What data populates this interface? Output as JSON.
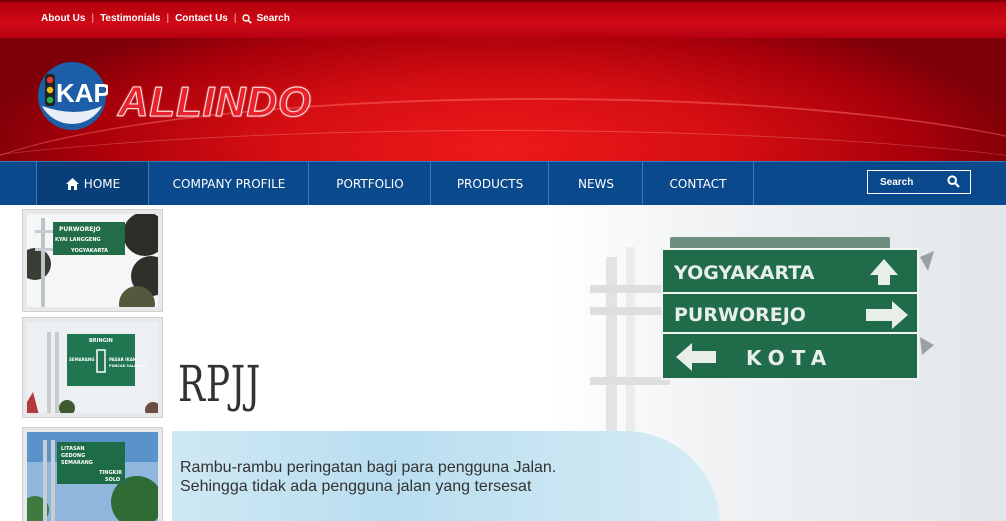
{
  "topbar": {
    "links": [
      "About Us",
      "Testimonials",
      "Contact Us"
    ],
    "search_label": "Search"
  },
  "brand": {
    "logo_badge": "KAP",
    "name": "ALLINDO"
  },
  "nav": {
    "items": [
      "HOME",
      "COMPANY PROFILE",
      "PORTFOLIO",
      "PRODUCTS",
      "NEWS",
      "CONTACT"
    ],
    "search_placeholder": "Search"
  },
  "slide": {
    "title": "RPJJ",
    "caption_line1": "Rambu-rambu peringatan bagi para pengguna Jalan.",
    "caption_line2": "Sehingga tidak ada pengguna jalan yang tersesat"
  },
  "thumbnails": [
    {
      "sign_lines": [
        "PURWOREJO",
        "KYAI LANGGENG",
        "YOGYAKARTA"
      ]
    },
    {
      "sign_lines": [
        "BRINGIN",
        "SEMARANG",
        "PASAR IKAN",
        "PUNCAK SALATIGA"
      ]
    },
    {
      "sign_lines": [
        "LITASAN",
        "GEDONG",
        "SEMARANG",
        "TINGKIR",
        "SOLO"
      ]
    }
  ],
  "big_sign": {
    "lines": [
      "YOGYAKARTA",
      "PURWOREJO",
      "KOTA"
    ]
  },
  "colors": {
    "topbar_red": "#c00612",
    "header_red": "#d40e12",
    "nav_blue": "#0a4a8c",
    "sign_green": "#1f6b4a",
    "caption_blue": "#bfe0f0"
  }
}
